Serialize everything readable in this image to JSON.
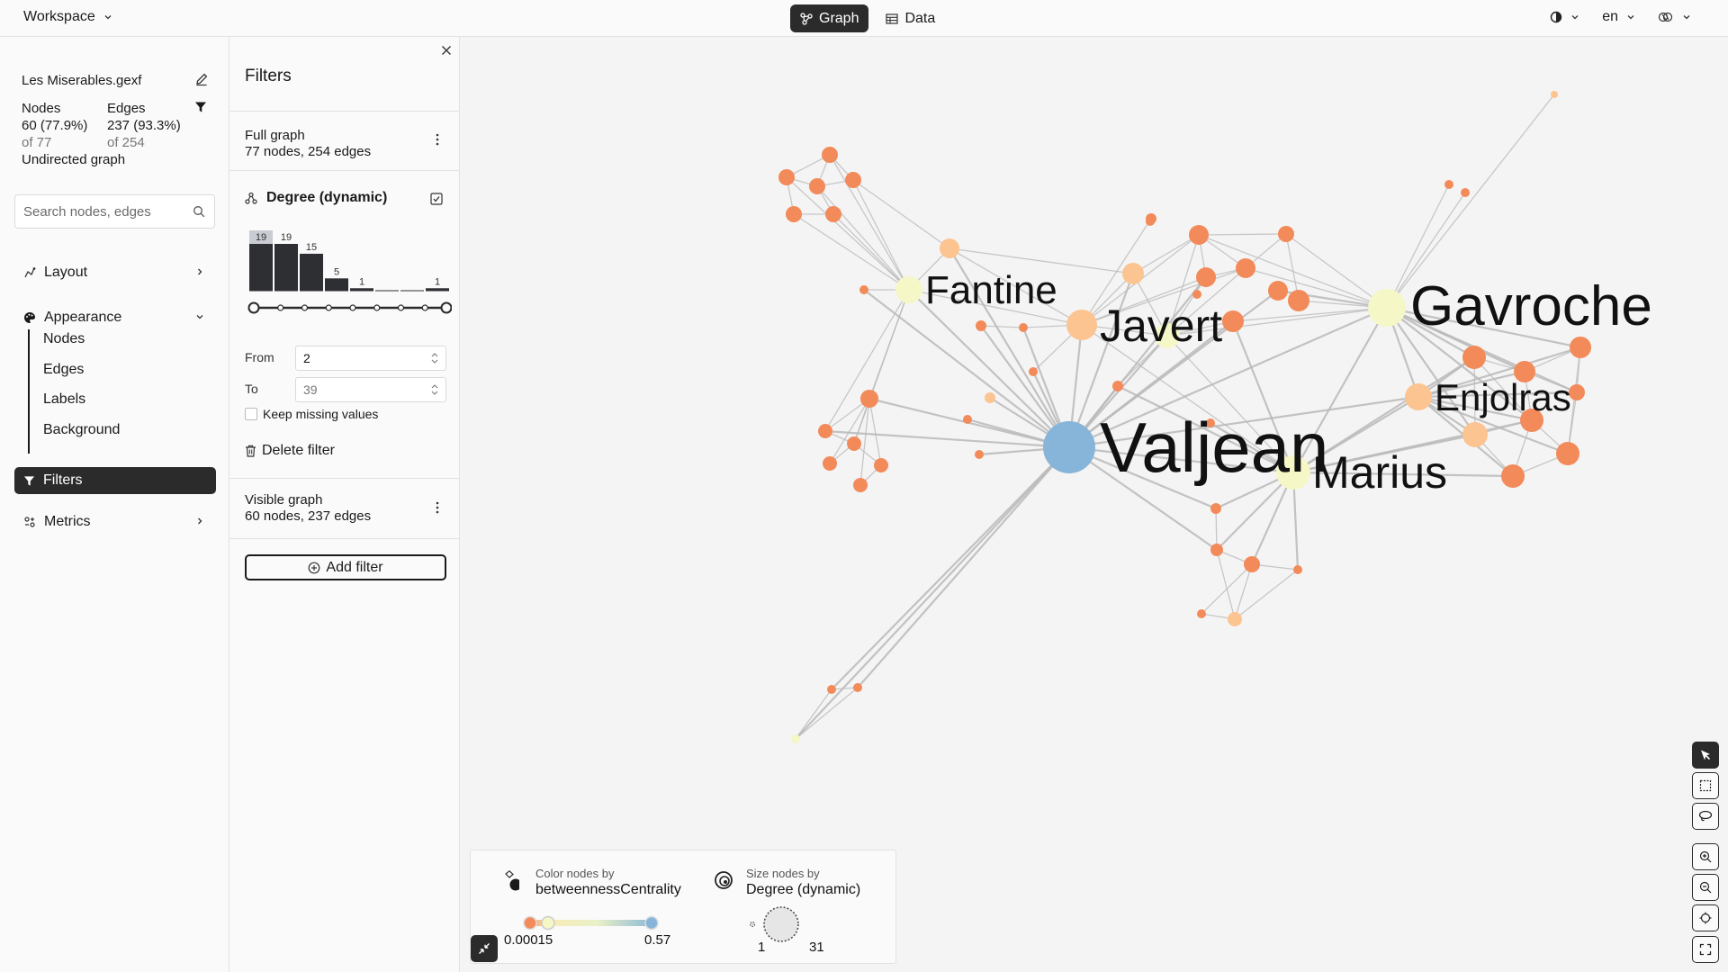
{
  "topbar": {
    "workspace_label": "Workspace",
    "tabs": [
      {
        "label": "Graph",
        "icon": "graph-icon",
        "active": true
      },
      {
        "label": "Data",
        "icon": "table-icon",
        "active": false
      }
    ],
    "theme_icon": "contrast-icon",
    "language": "en",
    "user_icon": "user-menu-icon"
  },
  "left": {
    "file_name": "Les Miserables.gexf",
    "nodes_label": "Nodes",
    "nodes_value": "60 (77.9%)",
    "nodes_total": "of 77",
    "edges_label": "Edges",
    "edges_value": "237 (93.3%)",
    "edges_total": "of 254",
    "graph_type": "Undirected graph",
    "search_placeholder": "Search nodes, edges",
    "nav": {
      "layout": "Layout",
      "appearance": "Appearance",
      "sub": [
        "Nodes",
        "Edges",
        "Labels",
        "Background"
      ],
      "filters": "Filters",
      "metrics": "Metrics"
    }
  },
  "filters": {
    "title": "Filters",
    "full_graph_title": "Full graph",
    "full_graph_detail": "77 nodes, 254 edges",
    "degree_title": "Degree (dynamic)",
    "histogram": {
      "bars": [
        19,
        19,
        15,
        5,
        1,
        0,
        0,
        1
      ],
      "labels": [
        "19",
        "19",
        "15",
        "5",
        "1",
        "1"
      ]
    },
    "from_label": "From",
    "from_value": "2",
    "to_label": "To",
    "to_value": "39",
    "keep_missing": "Keep missing values",
    "delete_filter": "Delete filter",
    "visible_graph_title": "Visible graph",
    "visible_graph_detail": "60 nodes, 237 edges",
    "add_filter": "Add filter"
  },
  "graph": {
    "labels": {
      "valjean": "Valjean",
      "marius": "Marius",
      "gavroche": "Gavroche",
      "javert": "Javert",
      "enjolras": "Enjolras",
      "fantine": "Fantine"
    },
    "colors": {
      "high": "#87b5d9",
      "mid": "#f5f7c6",
      "peach": "#fcc490",
      "low": "#f38a5a",
      "edge": "#b8b8b8"
    }
  },
  "legend": {
    "color_caption": "Color nodes by",
    "color_attr": "betweennessCentrality",
    "color_min": "0.00015",
    "color_max": "0.57",
    "size_caption": "Size nodes by",
    "size_attr": "Degree (dynamic)",
    "size_min": "1",
    "size_max": "31"
  },
  "tools": [
    "pointer-icon",
    "rect-select-icon",
    "lasso-icon",
    "zoom-in-icon",
    "zoom-out-icon",
    "center-icon",
    "fullscreen-icon"
  ]
}
